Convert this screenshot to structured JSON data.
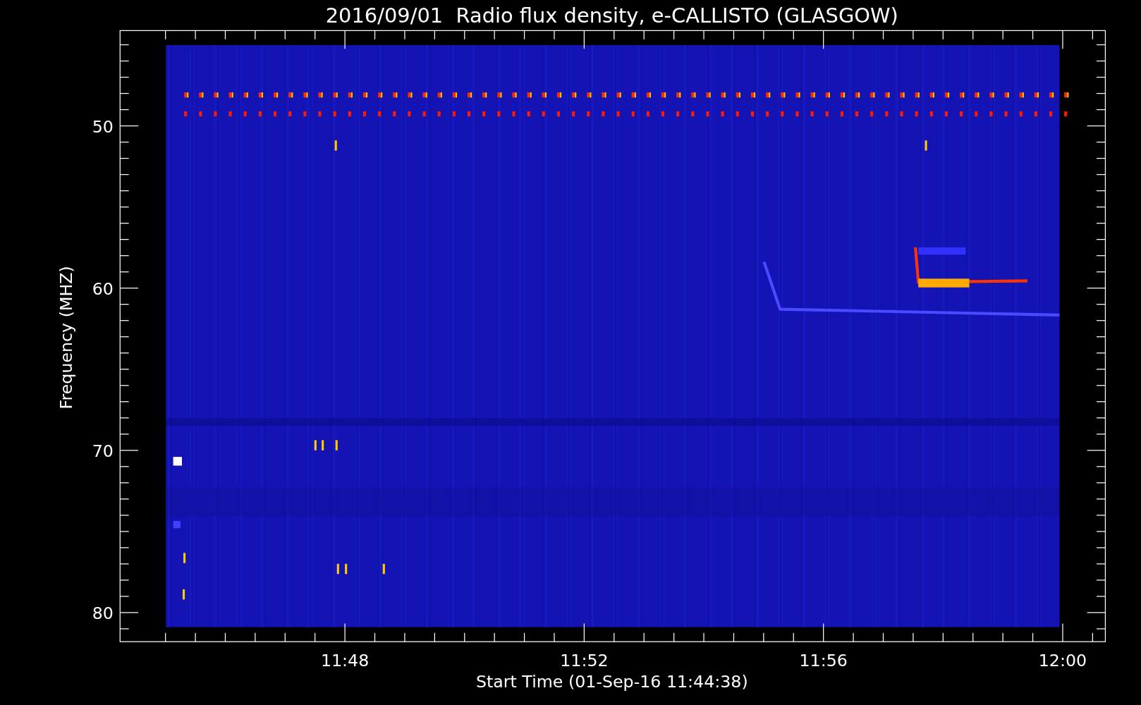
{
  "plot": {
    "title": "2016/09/01  Radio flux density, e-CALLISTO (GLASGOW)",
    "y_axis": {
      "label": "Frequency (MHZ)",
      "ticks": [
        "50",
        "60",
        "70",
        "80"
      ]
    },
    "x_axis": {
      "label": "Start Time (01-Sep-16 11:44:38)",
      "ticks": [
        "11:48",
        "11:52",
        "11:56",
        "12:00"
      ]
    }
  }
}
